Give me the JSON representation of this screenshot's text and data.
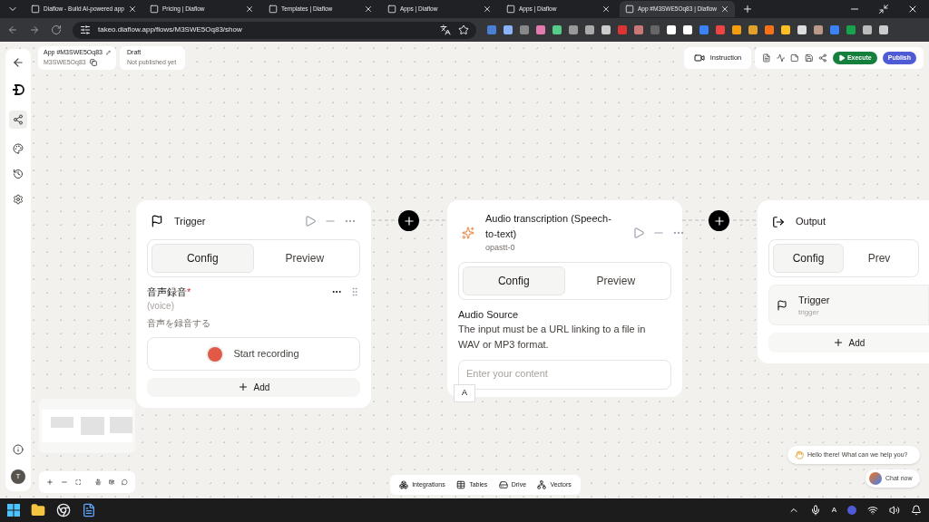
{
  "browser": {
    "tabs": [
      {
        "title": "Diaflow - Build AI-powered app",
        "selected": false
      },
      {
        "title": "Pricing | Diaflow",
        "selected": false
      },
      {
        "title": "Templates | Diaflow",
        "selected": false
      },
      {
        "title": "Apps | Diaflow",
        "selected": false
      },
      {
        "title": "Apps | Diaflow",
        "selected": false
      },
      {
        "title": "App #M3SWE5Oq83 | Diaflow",
        "selected": true
      }
    ],
    "url": "takeo.diaflow.app/flows/M3SWE5Oq83/show"
  },
  "header": {
    "app_title": "App #M3SWE5Oq83",
    "app_id": "M3SWE5Oq83",
    "status": "Draft",
    "status_note": "Not published yet",
    "instruction": "Instruction",
    "execute": "Execute",
    "publish": "Publish"
  },
  "sidebar": {
    "avatar": "T"
  },
  "trigger_node": {
    "title": "Trigger",
    "tabs": [
      {
        "label": "Config",
        "selected": true
      },
      {
        "label": "Preview",
        "selected": false
      }
    ],
    "field": {
      "label": "音声録音",
      "required_mark": "*",
      "hint": "(voice)",
      "description": "音声を録音する"
    },
    "record_button": "Start recording",
    "add": "Add"
  },
  "audio_node": {
    "title": "Audio transcription (Speech-to-text)",
    "subtitle": "opastt-0",
    "tabs": [
      {
        "label": "Config",
        "selected": true
      },
      {
        "label": "Preview",
        "selected": false
      }
    ],
    "section": "Audio Source",
    "description": "The input must be a URL linking to a file in WAV or MP3 format.",
    "placeholder": "Enter your content",
    "tooltip": "A"
  },
  "output_node": {
    "title": "Output",
    "tabs": [
      {
        "label": "Config",
        "selected": true
      },
      {
        "label": "Prev",
        "selected": false
      }
    ],
    "item": {
      "title": "Trigger",
      "subtitle": "trigger"
    },
    "add": "Add"
  },
  "bottom_bar": [
    "Integrations",
    "Tables",
    "Drive",
    "Vectors"
  ],
  "chat": {
    "greeting": "Hello there! What can we help you?",
    "button": "Chat now"
  },
  "taskbar": {
    "input_indicator": "A"
  }
}
